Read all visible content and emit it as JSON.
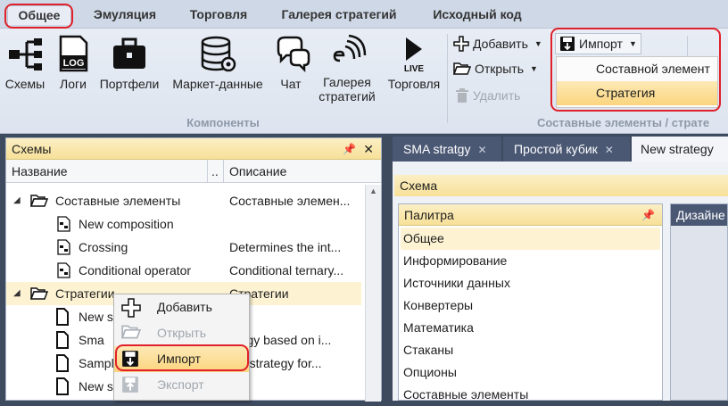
{
  "ribbon": {
    "tabs": [
      "Общее",
      "Эмуляция",
      "Торговля",
      "Галерея стратегий",
      "Исходный код"
    ],
    "buttons": {
      "schemes": "Схемы",
      "logs": "Логи",
      "portfolios": "Портфели",
      "market_data": "Маркет-данные",
      "chat": "Чат",
      "gallery_line1": "Галерея",
      "gallery_line2": "стратегий",
      "trading": "Торговля"
    },
    "group_components": "Компоненты",
    "group_composite": "Составные элементы / страте",
    "add": "Добавить",
    "open": "Открыть",
    "delete": "Удалить",
    "import": "Импорт",
    "import_menu": [
      "Составной элемент",
      "Стратегия"
    ],
    "icon_text_log": "LOG",
    "icon_text_live": "LIVE"
  },
  "schemes_panel": {
    "title": "Схемы",
    "col_name": "Название",
    "col_dots": "..",
    "col_desc": "Описание",
    "rows": [
      {
        "name": "Составные элементы",
        "desc": "Составные элемен..."
      },
      {
        "name": "New composition",
        "desc": ""
      },
      {
        "name": "Crossing",
        "desc": "Determines the int..."
      },
      {
        "name": "Conditional operator",
        "desc": "Conditional ternary..."
      },
      {
        "name": "Стратегии",
        "desc": "Стратегии"
      },
      {
        "name": "New s",
        "desc": ""
      },
      {
        "name": "Sma",
        "desc": "ategy based on i..."
      },
      {
        "name": "Sampl",
        "desc": "ple strategy for..."
      },
      {
        "name": "New s",
        "desc": ""
      }
    ]
  },
  "context_menu": [
    "Добавить",
    "Открыть",
    "Импорт",
    "Экспорт"
  ],
  "doc_tabs": [
    "SMA stratgy",
    "Простой кубик",
    "New strategy"
  ],
  "schema_label": "Схема",
  "palette": {
    "title": "Палитра",
    "items": [
      "Общее",
      "Информирование",
      "Источники данных",
      "Конвертеры",
      "Математика",
      "Стаканы",
      "Опционы",
      "Составные элементы"
    ]
  },
  "designer_label": "Дизайне"
}
